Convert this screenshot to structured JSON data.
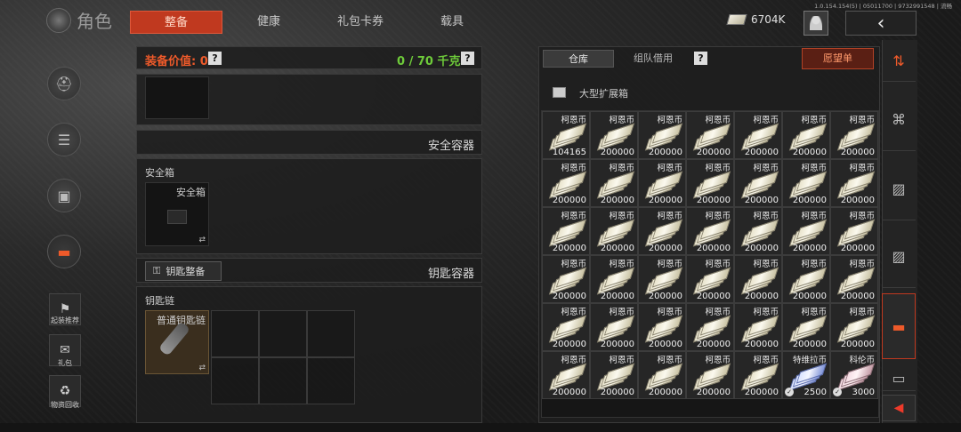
{
  "header": {
    "title": "角色",
    "tabs": [
      {
        "label": "整备",
        "active": true
      },
      {
        "label": "健康",
        "active": false
      },
      {
        "label": "礼包卡券",
        "active": false
      },
      {
        "label": "载具",
        "active": false
      }
    ],
    "version": "1.0.154.154(5) | 05011700 | 9732991548 | 流畅",
    "money": "6704K",
    "back_icon": "chevron-left-icon",
    "accent_color": "#c0391f"
  },
  "left_menu": {
    "circle_icons": [
      "helmet-icon",
      "armor-icon",
      "backpack-icon",
      "toolbox-icon"
    ],
    "buttons": [
      {
        "label": "起装推荐",
        "icon": "recommend-icon"
      },
      {
        "label": "礼包",
        "icon": "gift-icon"
      },
      {
        "label": "物资回收",
        "icon": "recycle-icon"
      }
    ]
  },
  "equipment": {
    "value_label": "装备价值: 0",
    "help": "?",
    "capacity": "0 / 70 千克",
    "safe_container_title": "安全容器",
    "safe_box_label": "安全箱",
    "safe_box_item": "安全箱",
    "key_button": "钥匙整备",
    "key_container_title": "钥匙容器",
    "keychain_label": "钥匙链",
    "keychain_item": "普通钥匙链",
    "swap_glyph": "⇄"
  },
  "warehouse": {
    "tabs": [
      {
        "label": "仓库",
        "active": true
      },
      {
        "label": "组队借用",
        "active": false
      }
    ],
    "help": "?",
    "wishlist": "愿望单",
    "container_name": "大型扩展箱",
    "items": [
      {
        "name": "柯恩币",
        "qty": "104165",
        "style": "cash"
      },
      {
        "name": "柯恩币",
        "qty": "200000",
        "style": "cash"
      },
      {
        "name": "柯恩币",
        "qty": "200000",
        "style": "cash"
      },
      {
        "name": "柯恩币",
        "qty": "200000",
        "style": "cash"
      },
      {
        "name": "柯恩币",
        "qty": "200000",
        "style": "cash"
      },
      {
        "name": "柯恩币",
        "qty": "200000",
        "style": "cash"
      },
      {
        "name": "柯恩币",
        "qty": "200000",
        "style": "cash"
      },
      {
        "name": "柯恩币",
        "qty": "200000",
        "style": "cash"
      },
      {
        "name": "柯恩币",
        "qty": "200000",
        "style": "cash"
      },
      {
        "name": "柯恩币",
        "qty": "200000",
        "style": "cash"
      },
      {
        "name": "柯恩币",
        "qty": "200000",
        "style": "cash"
      },
      {
        "name": "柯恩币",
        "qty": "200000",
        "style": "cash"
      },
      {
        "name": "柯恩币",
        "qty": "200000",
        "style": "cash"
      },
      {
        "name": "柯恩币",
        "qty": "200000",
        "style": "cash"
      },
      {
        "name": "柯恩币",
        "qty": "200000",
        "style": "cash"
      },
      {
        "name": "柯恩币",
        "qty": "200000",
        "style": "cash"
      },
      {
        "name": "柯恩币",
        "qty": "200000",
        "style": "cash"
      },
      {
        "name": "柯恩币",
        "qty": "200000",
        "style": "cash"
      },
      {
        "name": "柯恩币",
        "qty": "200000",
        "style": "cash"
      },
      {
        "name": "柯恩币",
        "qty": "200000",
        "style": "cash"
      },
      {
        "name": "柯恩币",
        "qty": "200000",
        "style": "cash"
      },
      {
        "name": "柯恩币",
        "qty": "200000",
        "style": "cash"
      },
      {
        "name": "柯恩币",
        "qty": "200000",
        "style": "cash"
      },
      {
        "name": "柯恩币",
        "qty": "200000",
        "style": "cash"
      },
      {
        "name": "柯恩币",
        "qty": "200000",
        "style": "cash"
      },
      {
        "name": "柯恩币",
        "qty": "200000",
        "style": "cash"
      },
      {
        "name": "柯恩币",
        "qty": "200000",
        "style": "cash"
      },
      {
        "name": "柯恩币",
        "qty": "200000",
        "style": "cash"
      },
      {
        "name": "柯恩币",
        "qty": "200000",
        "style": "cash"
      },
      {
        "name": "柯恩币",
        "qty": "200000",
        "style": "cash"
      },
      {
        "name": "柯恩币",
        "qty": "200000",
        "style": "cash"
      },
      {
        "name": "柯恩币",
        "qty": "200000",
        "style": "cash"
      },
      {
        "name": "柯恩币",
        "qty": "200000",
        "style": "cash"
      },
      {
        "name": "柯恩币",
        "qty": "200000",
        "style": "cash"
      },
      {
        "name": "柯恩币",
        "qty": "200000",
        "style": "cash"
      },
      {
        "name": "柯恩币",
        "qty": "200000",
        "style": "cash"
      },
      {
        "name": "柯恩币",
        "qty": "200000",
        "style": "cash"
      },
      {
        "name": "柯恩币",
        "qty": "200000",
        "style": "cash"
      },
      {
        "name": "柯恩币",
        "qty": "200000",
        "style": "cash"
      },
      {
        "name": "柯恩币",
        "qty": "200000",
        "style": "cash"
      },
      {
        "name": "特维拉币",
        "qty": "2500",
        "style": "blue"
      },
      {
        "name": "科伦币",
        "qty": "3000",
        "style": "pink"
      }
    ]
  },
  "right_strip": {
    "tabs": [
      "sort-icon",
      "medkit-icon",
      "box-icon",
      "box-icon",
      "toolbox-icon",
      "crate-icon"
    ],
    "active_index": 4,
    "collapse_icon": "arrow-left-icon"
  }
}
